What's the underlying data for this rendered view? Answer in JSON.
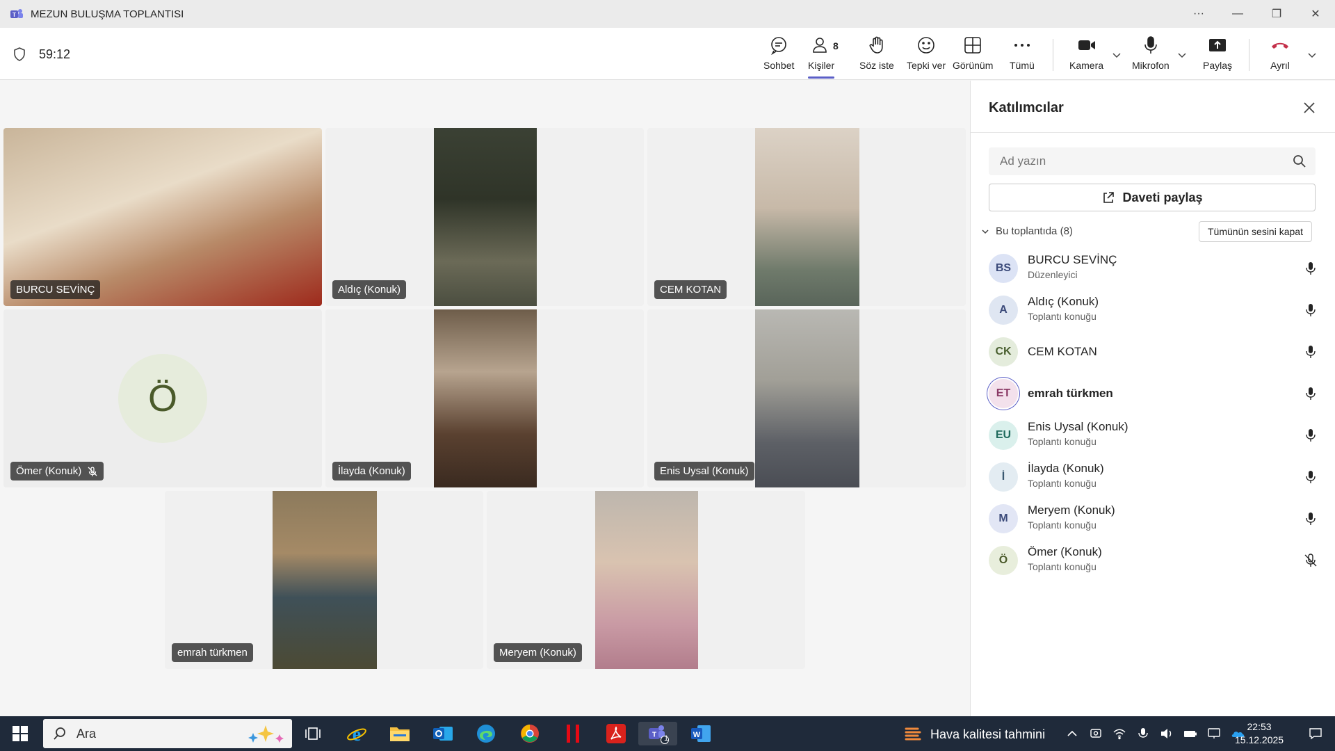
{
  "window": {
    "title": "MEZUN BULUŞMA TOPLANTISI",
    "controls": [
      "···",
      "—",
      "❐",
      "✕"
    ]
  },
  "toolbar": {
    "timer": "59:12",
    "buttons": {
      "chat": "Sohbet",
      "people": "Kişiler",
      "people_count": "8",
      "raise": "Söz iste",
      "react": "Tepki ver",
      "view": "Görünüm",
      "more": "Tümü",
      "camera": "Kamera",
      "mic": "Mikrofon",
      "share": "Paylaş",
      "leave": "Ayrıl"
    },
    "leave_color": "#c4314b"
  },
  "stage": {
    "tiles": [
      {
        "name": "BURCU SEVİNÇ"
      },
      {
        "name": "Aldıç (Konuk)"
      },
      {
        "name": "CEM KOTAN"
      },
      {
        "name": "Ömer (Konuk)",
        "initial": "Ö",
        "muted": true
      },
      {
        "name": "İlayda (Konuk)"
      },
      {
        "name": "Enis Uysal (Konuk)"
      },
      {
        "name": "emrah türkmen"
      },
      {
        "name": "Meryem (Konuk)"
      }
    ]
  },
  "panel": {
    "title": "Katılımcılar",
    "search_placeholder": "Ad yazın",
    "invite_label": "Daveti paylaş",
    "section_label": "Bu toplantıda (8)",
    "mute_all": "Tümünün sesini kapat",
    "participants": [
      {
        "initials": "BS",
        "name": "BURCU SEVİNÇ",
        "role": "Düzenleyici",
        "muted": false,
        "color": "#dce3f5",
        "fg": "#3b4a7a"
      },
      {
        "initials": "A",
        "name": "Aldıç (Konuk)",
        "role": "Toplantı konuğu",
        "muted": false,
        "color": "#dfe6f2",
        "fg": "#3b4a7a"
      },
      {
        "initials": "CK",
        "name": "CEM KOTAN",
        "role": "",
        "muted": false,
        "color": "#e4ecdc",
        "fg": "#4a6030"
      },
      {
        "initials": "ET",
        "name": "emrah türkmen",
        "role": "",
        "muted": false,
        "color": "#f3e1ec",
        "fg": "#8a3a66"
      },
      {
        "initials": "EU",
        "name": "Enis Uysal (Konuk)",
        "role": "Toplantı konuğu",
        "muted": false,
        "color": "#daf0ec",
        "fg": "#1f6a5c"
      },
      {
        "initials": "İ",
        "name": "İlayda (Konuk)",
        "role": "Toplantı konuğu",
        "muted": false,
        "color": "#e3ecf2",
        "fg": "#3a5870"
      },
      {
        "initials": "M",
        "name": "Meryem (Konuk)",
        "role": "Toplantı konuğu",
        "muted": false,
        "color": "#e2e6f5",
        "fg": "#3b4a7a"
      },
      {
        "initials": "Ö",
        "name": "Ömer (Konuk)",
        "role": "Toplantı konuğu",
        "muted": true,
        "color": "#e8eedc",
        "fg": "#4a5a2a"
      }
    ]
  },
  "taskbar": {
    "search_label": "Ara",
    "weather": "Hava kalitesi tahmini",
    "time": "22:53",
    "date": "15.12.2025",
    "teams_badge": "1"
  }
}
